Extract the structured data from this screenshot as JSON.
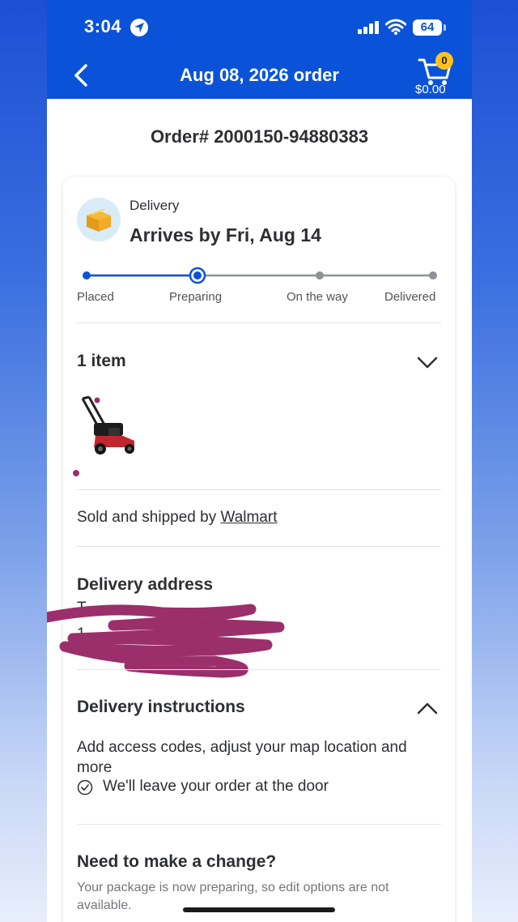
{
  "status_bar": {
    "time": "3:04",
    "battery": "64"
  },
  "header": {
    "title": "Aug 08, 2026 order",
    "cart_count": "0",
    "cart_total": "$0.00"
  },
  "order": {
    "number": "Order# 2000150-94880383"
  },
  "delivery": {
    "type": "Delivery",
    "arrival": "Arrives by Fri, Aug 14",
    "current_step_index": 1,
    "steps": [
      "Placed",
      "Preparing",
      "On the way",
      "Delivered"
    ]
  },
  "items": {
    "count_label": "1 item",
    "product_icon": "lawn-mower-image"
  },
  "seller": {
    "prefix": "Sold and shipped by ",
    "name": "Walmart"
  },
  "address": {
    "heading": "Delivery address",
    "line1": "T",
    "line2": "1"
  },
  "instructions": {
    "heading": "Delivery instructions",
    "text": "Add access codes, adjust your map location and more",
    "note": "We'll leave your order at the door"
  },
  "change": {
    "heading": "Need to make a change?",
    "note": "Your package is now preparing, so edit options are not available."
  },
  "colors": {
    "brand_blue": "#0a53d9",
    "badge_yellow": "#ffc220",
    "redaction": "#9b2f6b"
  }
}
